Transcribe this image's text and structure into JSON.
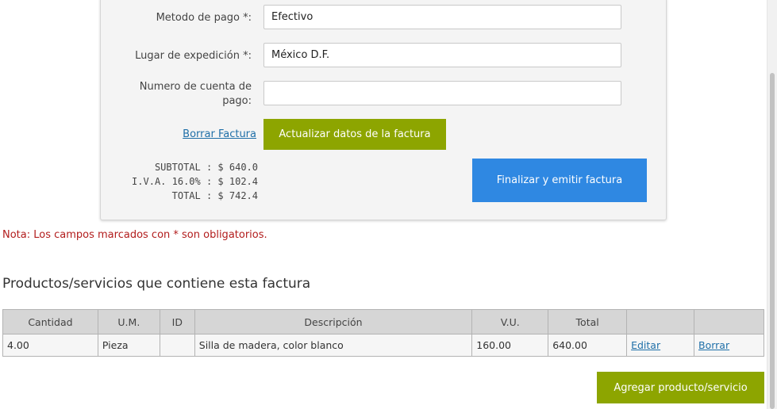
{
  "form": {
    "payment_method_label": "Metodo de pago *:",
    "payment_method_value": "Efectivo",
    "place_label": "Lugar de expedición *:",
    "place_value": "México D.F.",
    "account_label_line1": "Numero de cuenta de",
    "account_label_line2": "pago:",
    "account_value": ""
  },
  "actions": {
    "delete_invoice": "Borrar Factura",
    "update_invoice": "Actualizar datos de la factura",
    "finalize_invoice": "Finalizar y emitir factura",
    "add_product": "Agregar producto/servicio"
  },
  "totals": {
    "subtotal": "SUBTOTAL : $ 640.0",
    "iva": "I.V.A. 16.0% : $ 102.4",
    "total": "TOTAL : $ 742.4"
  },
  "note": "Nota: Los campos marcados con * son obligatorios.",
  "section_title": "Productos/servicios que contiene esta factura",
  "table": {
    "headers": [
      "Cantidad",
      "U.M.",
      "ID",
      "Descripción",
      "V.U.",
      "Total",
      "",
      ""
    ],
    "rows": [
      {
        "cantidad": "4.00",
        "um": "Pieza",
        "id": "",
        "descripcion": "Silla de madera, color blanco",
        "vu": "160.00",
        "total": "640.00",
        "edit": "Editar",
        "delete": "Borrar"
      }
    ]
  },
  "colors": {
    "green_button": "#8da500",
    "blue_button": "#2f88e2",
    "note_red": "#b21c1c",
    "link_blue": "#1f6fa8"
  }
}
